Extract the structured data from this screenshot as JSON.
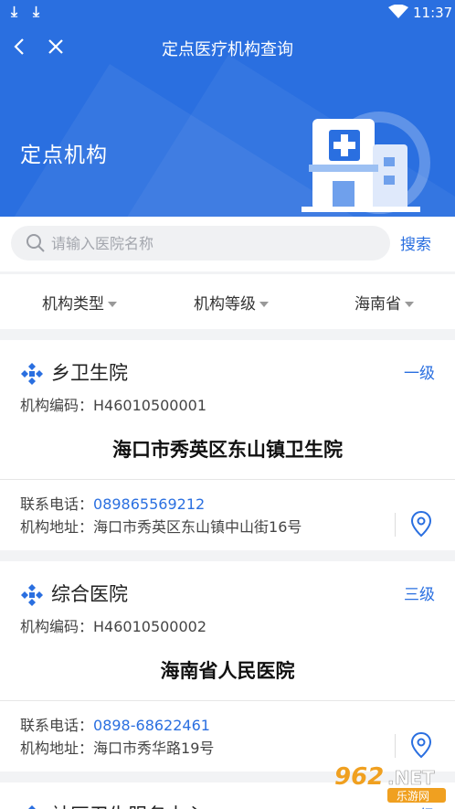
{
  "status_bar": {
    "time": "11:37"
  },
  "nav": {
    "title": "定点医疗机构查询"
  },
  "banner": {
    "title": "定点机构"
  },
  "search": {
    "placeholder": "请输入医院名称",
    "button": "搜索"
  },
  "filters": [
    {
      "label": "机构类型"
    },
    {
      "label": "机构等级"
    },
    {
      "label": "海南省"
    }
  ],
  "institutions": [
    {
      "category": "乡卫生院",
      "level": "一级",
      "code_label": "机构编码：",
      "code": "H46010500001",
      "name": "海口市秀英区东山镇卫生院",
      "phone_label": "联系电话：",
      "phone": "089865569212",
      "address_label": "机构地址：",
      "address": "海口市秀英区东山镇中山街16号"
    },
    {
      "category": "综合医院",
      "level": "三级",
      "code_label": "机构编码：",
      "code": "H46010500002",
      "name": "海南省人民医院",
      "phone_label": "联系电话：",
      "phone": "0898-68622461",
      "address_label": "机构地址：",
      "address": "海口市秀华路19号"
    },
    {
      "category": "社区卫生服务中心",
      "level": "一级"
    }
  ],
  "watermark": {
    "brand": "962.NET",
    "sub": "乐游网"
  },
  "colors": {
    "primary": "#2a6fe0",
    "background": "#f2f3f5"
  }
}
